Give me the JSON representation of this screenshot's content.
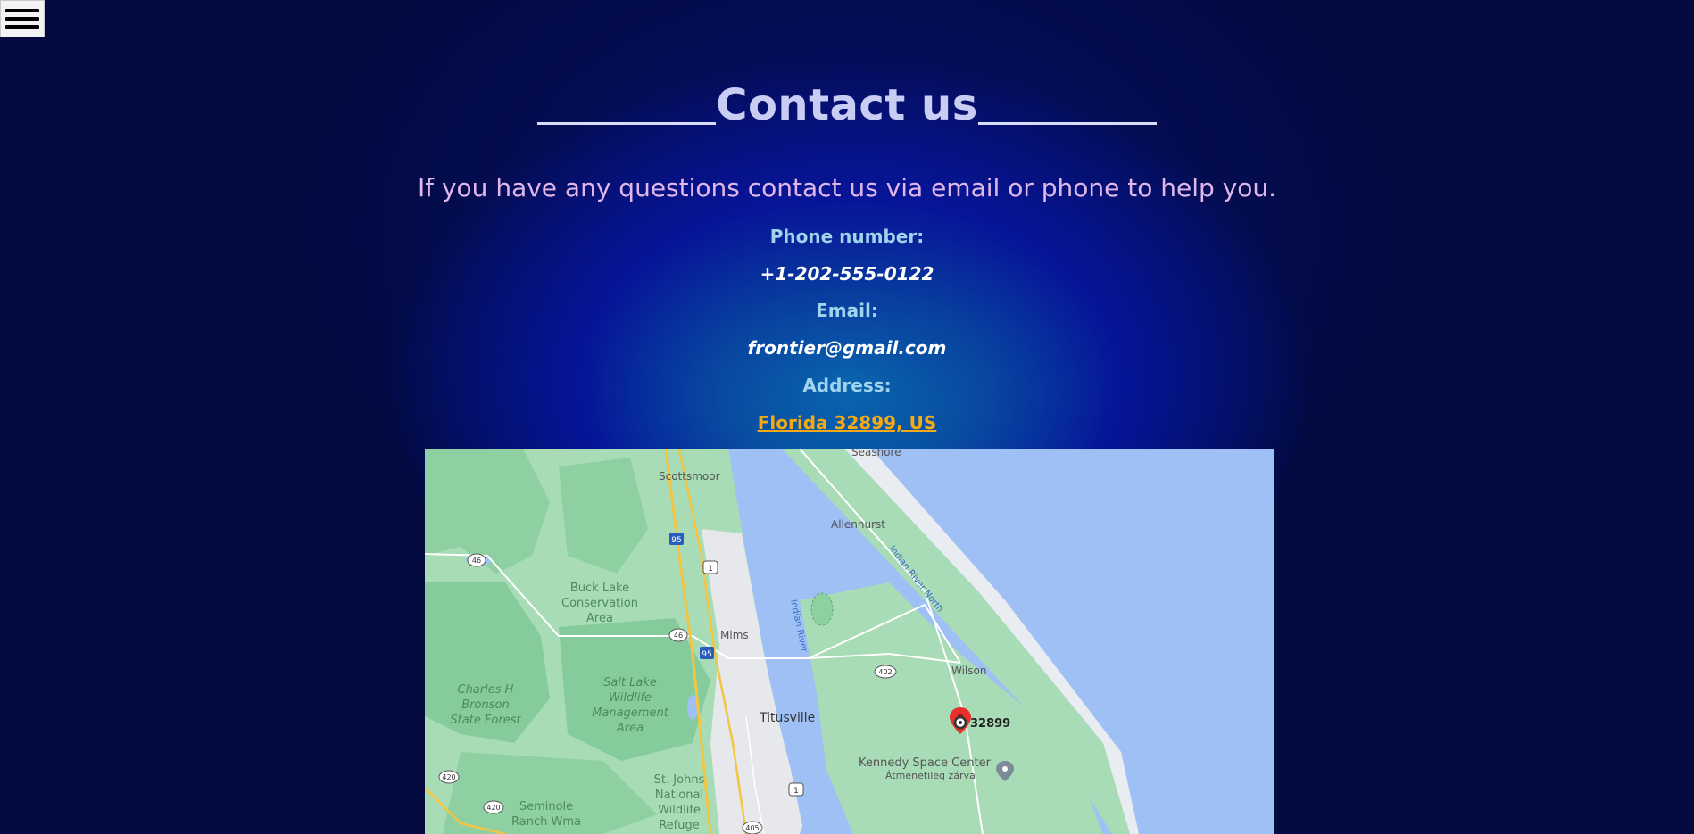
{
  "header": {
    "menu_icon": "hamburger-menu-icon"
  },
  "page": {
    "title": "Contact us",
    "intro": "If you have any questions contact us via email or phone to help you."
  },
  "contact": {
    "phone_label": "Phone number:",
    "phone": "+1-202-555-0122",
    "email_label": "Email:",
    "email": "frontier@gmail.com",
    "address_label": "Address:",
    "address": "Florida 32899, US"
  },
  "map": {
    "labels": {
      "seashore": "Seashore",
      "scottsmoor": "Scottsmoor",
      "allenhurst": "Allenhurst",
      "indian_river_north": "Indian River North",
      "buck_lake": [
        "Buck Lake",
        "Conservation",
        "Area"
      ],
      "indian_river": "Indian River",
      "mims": "Mims",
      "wilson": "Wilson",
      "charles_h": [
        "Charles H",
        "Bronson",
        "State Forest"
      ],
      "salt_lake": [
        "Salt Lake",
        "Wildlife",
        "Management",
        "Area"
      ],
      "titusville": "Titusville",
      "zip": "32899",
      "kennedy": "Kennedy Space Center",
      "kennedy_sub": "Átmenetileg zárva",
      "st_johns": [
        "St. Johns",
        "National",
        "Wildlife",
        "Refuge"
      ],
      "seminole": [
        "Seminole",
        "Ranch Wma"
      ]
    },
    "shields": {
      "i95": "95",
      "us1": "1",
      "r46": "46",
      "r402": "402",
      "r420": "420",
      "r405": "405"
    },
    "colors": {
      "water": "#9ec0f5",
      "land_green": "#9fd8b0",
      "forest_green": "#7ec795",
      "urban": "#e8eaed",
      "highway": "#f4c542",
      "marker": "#e8312a"
    }
  }
}
